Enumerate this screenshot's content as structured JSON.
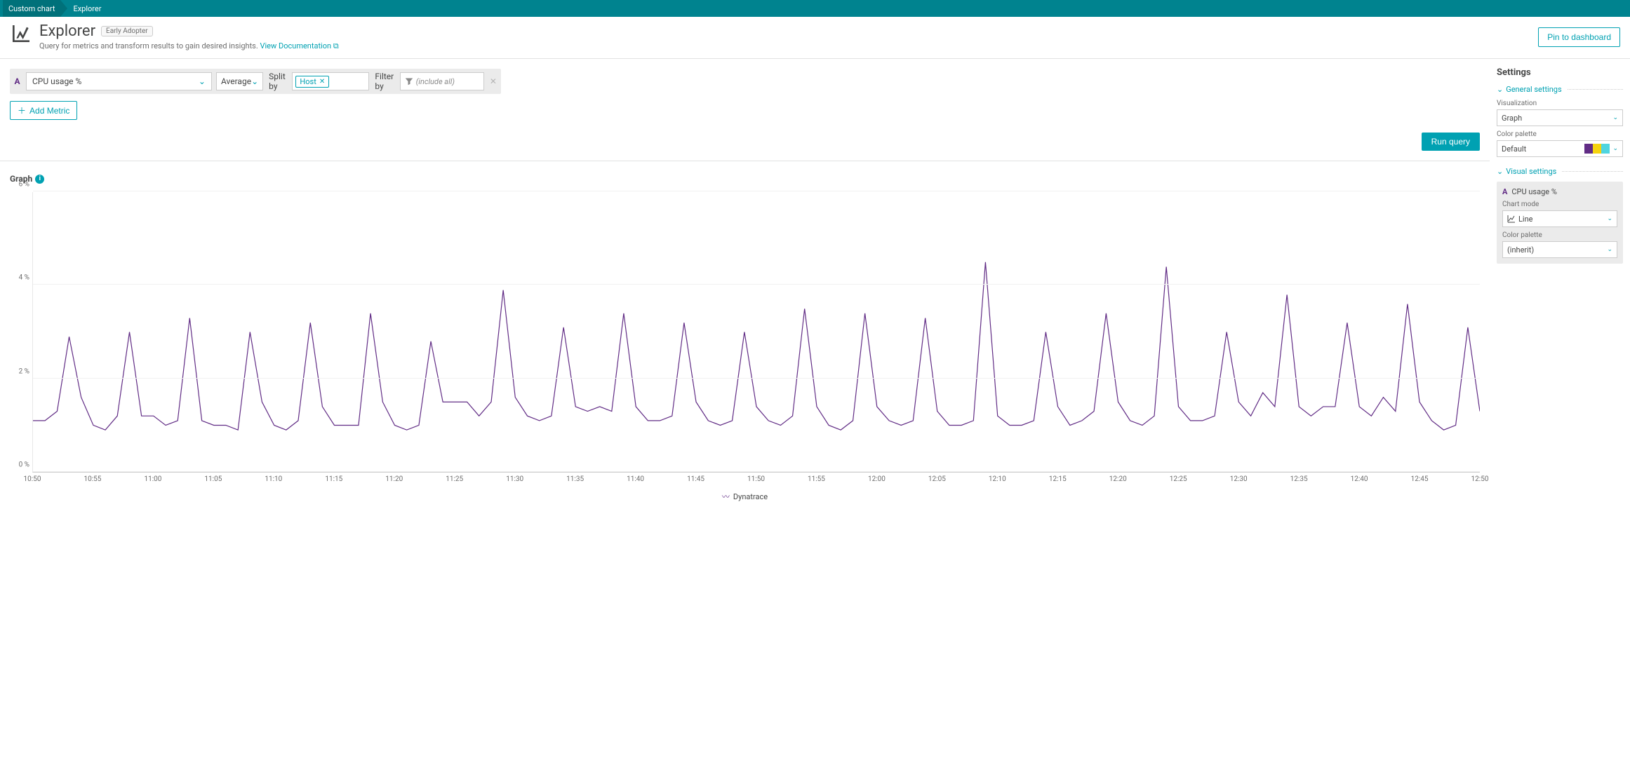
{
  "breadcrumb": {
    "prev": "Custom chart",
    "current": "Explorer"
  },
  "header": {
    "title": "Explorer",
    "badge": "Early Adopter",
    "subtitle_text": "Query for metrics and transform results to gain desired insights. ",
    "doc_link": "View Documentation",
    "pin_label": "Pin to dashboard"
  },
  "query": {
    "letter": "A",
    "metric": "CPU usage %",
    "aggregation": "Average",
    "splitby_label": "Split by",
    "splitby_tags": [
      "Host"
    ],
    "filterby_label": "Filter by",
    "filter_placeholder": "(include all)",
    "add_metric_label": "Add Metric",
    "run_label": "Run query"
  },
  "graph": {
    "title": "Graph",
    "legend_series": "Dynatrace"
  },
  "settings": {
    "title": "Settings",
    "general_label": "General settings",
    "visualization_label": "Visualization",
    "visualization_value": "Graph",
    "color_palette_label": "Color palette",
    "color_palette_value": "Default",
    "palette_swatches": [
      "#612c85",
      "#f5d30f",
      "#4fd5e0"
    ],
    "visual_label": "Visual settings",
    "series_title": "CPU usage %",
    "chart_mode_label": "Chart mode",
    "chart_mode_value": "Line",
    "series_palette_label": "Color palette",
    "series_palette_value": "(inherit)"
  },
  "chart_data": {
    "type": "line",
    "title": "",
    "xlabel": "",
    "ylabel": "",
    "ylim": [
      0,
      6
    ],
    "y_ticks": [
      0,
      2,
      4,
      6
    ],
    "y_tick_labels": [
      "0 %",
      "2 %",
      "4 %",
      "6 %"
    ],
    "x_tick_labels": [
      "10:50",
      "10:55",
      "11:00",
      "11:05",
      "11:10",
      "11:15",
      "11:20",
      "11:25",
      "11:30",
      "11:35",
      "11:40",
      "11:45",
      "11:50",
      "11:55",
      "12:00",
      "12:05",
      "12:10",
      "12:15",
      "12:20",
      "12:25",
      "12:30",
      "12:35",
      "12:40",
      "12:45",
      "12:50"
    ],
    "series": [
      {
        "name": "Dynatrace",
        "color": "#612c85",
        "values": [
          1.1,
          1.1,
          1.3,
          2.9,
          1.6,
          1.0,
          0.9,
          1.2,
          3.0,
          1.2,
          1.2,
          1.0,
          1.1,
          3.3,
          1.1,
          1.0,
          1.0,
          0.9,
          3.0,
          1.5,
          1.0,
          0.9,
          1.1,
          3.2,
          1.4,
          1.0,
          1.0,
          1.0,
          3.4,
          1.5,
          1.0,
          0.9,
          1.0,
          2.8,
          1.5,
          1.5,
          1.5,
          1.2,
          1.5,
          3.9,
          1.6,
          1.2,
          1.1,
          1.2,
          3.1,
          1.4,
          1.3,
          1.4,
          1.3,
          3.4,
          1.4,
          1.1,
          1.1,
          1.2,
          3.2,
          1.5,
          1.1,
          1.0,
          1.1,
          3.0,
          1.4,
          1.1,
          1.0,
          1.2,
          3.5,
          1.4,
          1.0,
          0.9,
          1.1,
          3.4,
          1.4,
          1.1,
          1.0,
          1.1,
          3.3,
          1.3,
          1.0,
          1.0,
          1.1,
          4.5,
          1.2,
          1.0,
          1.0,
          1.1,
          3.0,
          1.4,
          1.0,
          1.1,
          1.3,
          3.4,
          1.5,
          1.1,
          1.0,
          1.2,
          4.4,
          1.4,
          1.1,
          1.1,
          1.2,
          3.0,
          1.5,
          1.2,
          1.7,
          1.4,
          3.8,
          1.4,
          1.2,
          1.4,
          1.4,
          3.2,
          1.4,
          1.2,
          1.6,
          1.3,
          3.6,
          1.5,
          1.1,
          0.9,
          1.0,
          3.1,
          1.3
        ]
      }
    ]
  }
}
